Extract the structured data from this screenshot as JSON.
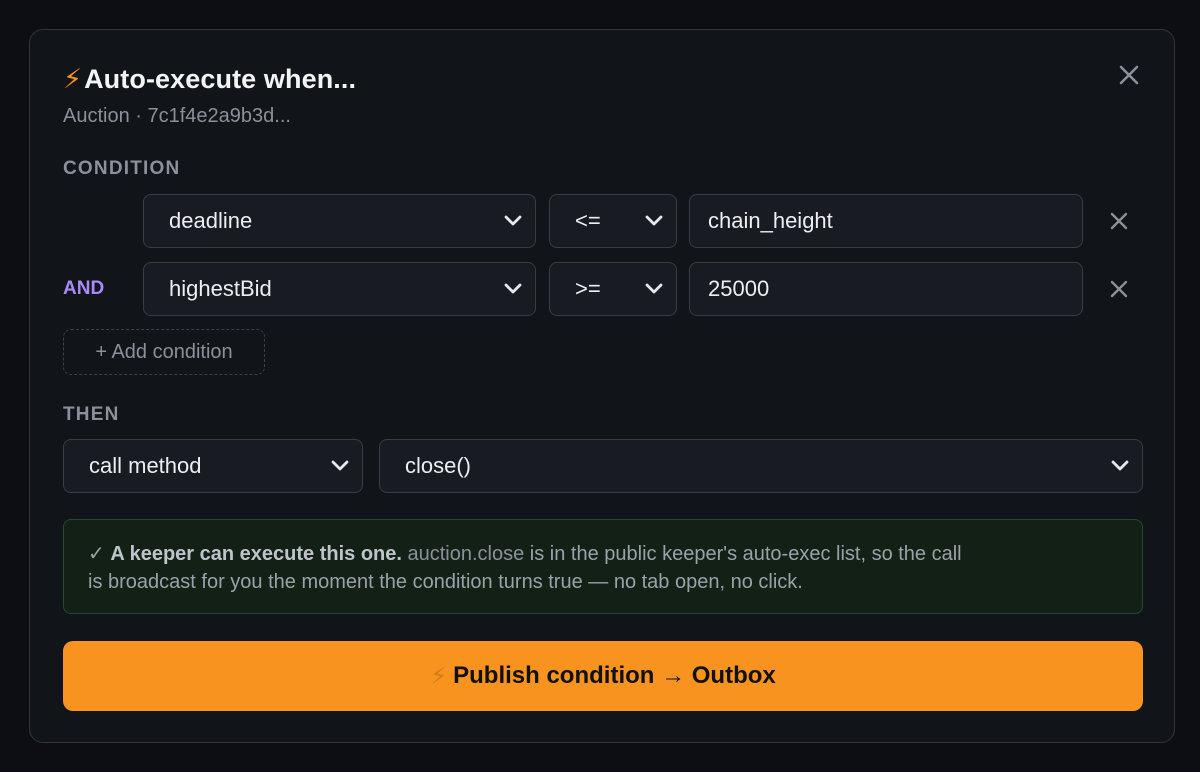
{
  "dialog": {
    "title_icon": "⚡",
    "title": "Auto-execute when...",
    "subtitle": "Auction · 7c1f4e2a9b3d..."
  },
  "condition": {
    "label": "CONDITION",
    "rows": [
      {
        "logic": "",
        "field": "deadline",
        "operator": "<=",
        "value": "chain_height"
      },
      {
        "logic": "AND",
        "field": "highestBid",
        "operator": ">=",
        "value": "25000"
      }
    ],
    "add_label": "+ Add condition"
  },
  "then": {
    "label": "THEN",
    "action": "call method",
    "method": "close()"
  },
  "notice": {
    "check": "✓",
    "bold": "A keeper can execute this one.",
    "code": "auction.close",
    "rest1": " is in the public keeper's auto-exec list, so the call",
    "rest2": "is broadcast for you the moment the condition turns true — no tab open, no click."
  },
  "publish": {
    "icon": "⚡",
    "label": "Publish condition → Outbox"
  },
  "colors": {
    "accent": "#f7931e",
    "logic": "#a78bfa",
    "success_bg": "#132016",
    "success_border": "#234a2c"
  }
}
